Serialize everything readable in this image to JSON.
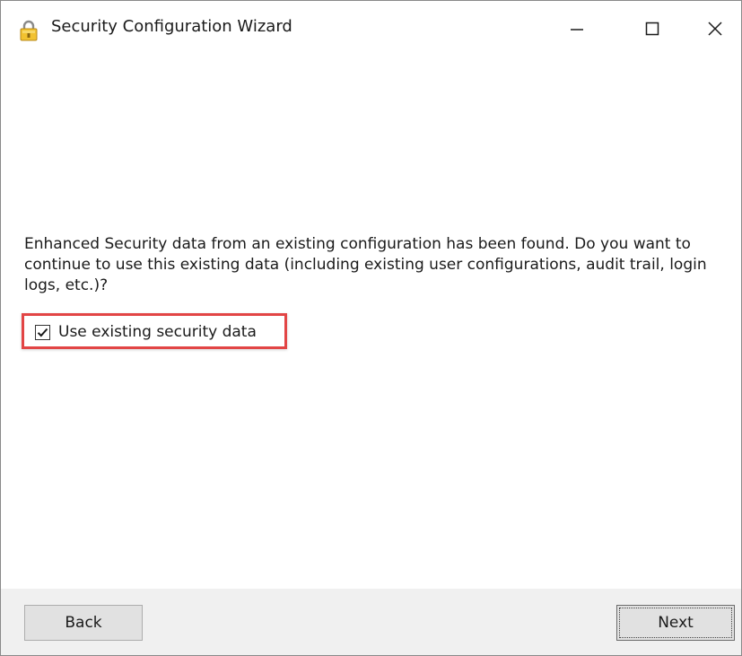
{
  "window": {
    "title": "Security Configuration Wizard",
    "icon": "padlock-icon",
    "controls": {
      "minimize": "minimize-icon",
      "maximize": "maximize-icon",
      "close": "close-icon"
    }
  },
  "content": {
    "message": "Enhanced Security data from an existing configuration has been found. Do you want to continue to use this existing data (including existing user configurations, audit trail, login logs, etc.)?",
    "checkbox": {
      "label": "Use existing security data",
      "checked": true
    },
    "highlight_color": "#e24545"
  },
  "footer": {
    "back_label": "Back",
    "next_label": "Next"
  }
}
